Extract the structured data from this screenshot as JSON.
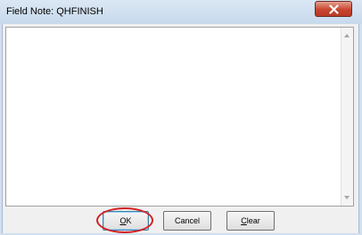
{
  "window": {
    "title": "Field Note: QHFINISH",
    "close_symbol": "✕"
  },
  "memo": {
    "value": ""
  },
  "buttons": {
    "ok_mnemonic": "O",
    "ok_rest": "K",
    "cancel_label": "Cancel",
    "clear_mnemonic": "C",
    "clear_rest": "lear"
  },
  "colors": {
    "close_button": "#c9452f",
    "highlight_circle": "#d42020",
    "titlebar": "#cfe0f1"
  },
  "icons": {
    "close": "close-icon",
    "scroll_up": "scroll-up-arrow-icon",
    "scroll_down": "scroll-down-arrow-icon"
  }
}
